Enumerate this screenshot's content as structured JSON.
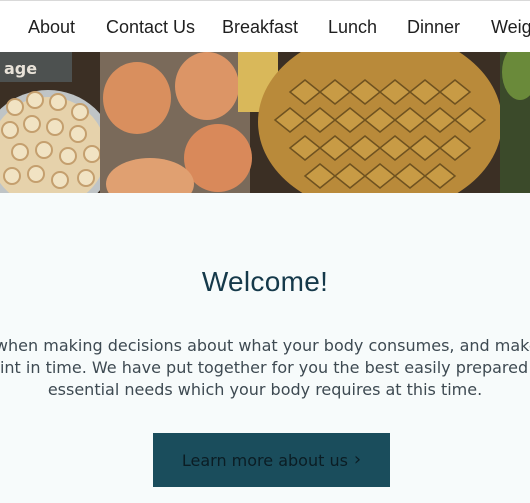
{
  "nav": {
    "items": [
      {
        "label": "About"
      },
      {
        "label": "Contact Us"
      },
      {
        "label": "Breakfast"
      },
      {
        "label": "Lunch"
      },
      {
        "label": "Dinner"
      },
      {
        "label": "Weig"
      }
    ]
  },
  "hero": {
    "badge_text": "age"
  },
  "welcome": {
    "title": "Welcome!",
    "lines": [
      "e when making decisions about what your body consumes, and make s",
      "point in time. We have put together for you the best easily prepared he",
      "essential needs which your body requires at this time."
    ],
    "cta_label": "Learn more about us",
    "cta_icon": "chevron-right-icon"
  },
  "colors": {
    "title": "#15394a",
    "cta_bg": "#1a4d5c",
    "body_text": "#3e4a52",
    "page_bg": "#f7fbfb"
  }
}
